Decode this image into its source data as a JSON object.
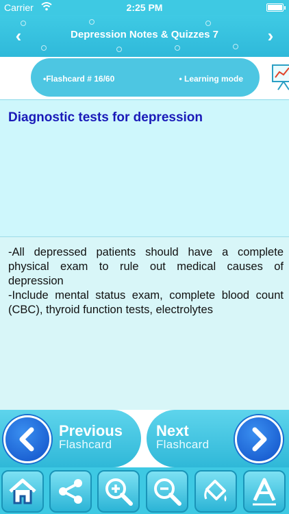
{
  "status_bar": {
    "carrier": "Carrier",
    "time": "2:25 PM",
    "battery_level": 1.0
  },
  "nav": {
    "title": "Depression Notes & Quizzes 7",
    "back_icon": "chevron-left-icon",
    "forward_icon": "chevron-right-icon"
  },
  "info": {
    "flashcard_number": "•Flashcard #  16/60",
    "mode": "• Learning mode"
  },
  "card": {
    "question": "Diagnostic tests for depression",
    "answer_lines": [
      "-All depressed patients should have a complete physical exam to rule out medical causes of depression",
      "-Include mental status exam, complete blood count (CBC), thyroid function tests, electrolytes"
    ]
  },
  "card_nav": {
    "previous_big": "Previous",
    "previous_small": "Flashcard",
    "next_big": "Next",
    "next_small": "Flashcard"
  },
  "toolbar": {
    "icons": [
      "home-icon",
      "share-icon",
      "zoom-in-icon",
      "zoom-out-icon",
      "paint-bucket-icon",
      "font-icon"
    ]
  },
  "colors": {
    "header": "#3ec9e3",
    "question_bg": "#cef7fc",
    "answer_bg": "#d8f6f8",
    "question_text": "#1a1ab8",
    "circle_button": "#1a6fd0"
  }
}
